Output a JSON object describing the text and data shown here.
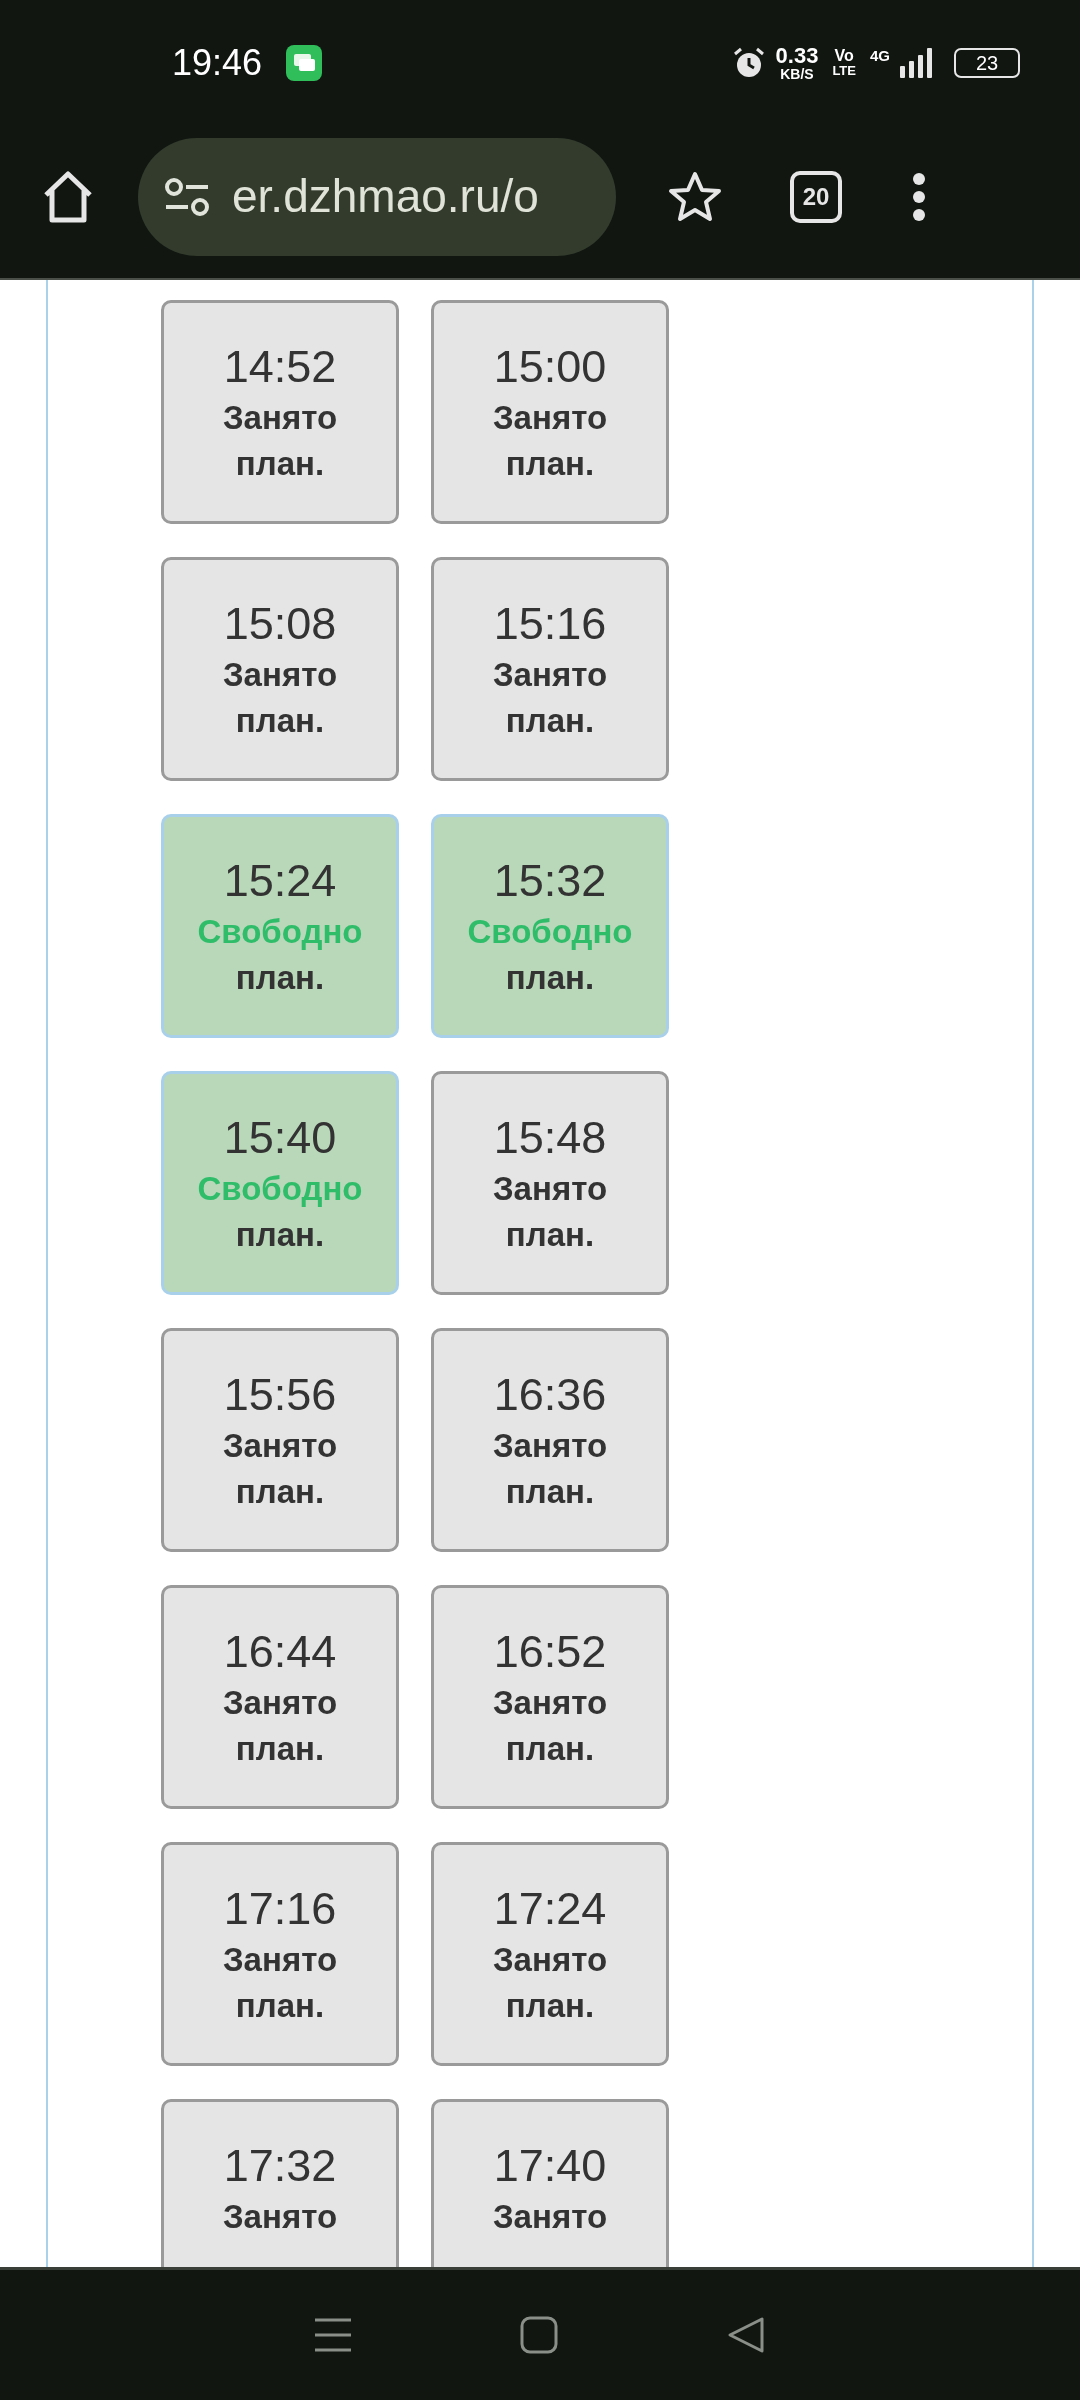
{
  "status_bar": {
    "time": "19:46",
    "speed_value": "0.33",
    "speed_unit": "KB/S",
    "volte_top": "Vo",
    "volte_bottom": "LTE",
    "network": "4G",
    "battery": "23"
  },
  "browser": {
    "url": "er.dzhmao.ru/o",
    "tab_count": "20"
  },
  "slots": [
    {
      "time": "14:52",
      "status": "Занято",
      "note": "план.",
      "kind": "busy"
    },
    {
      "time": "15:00",
      "status": "Занято",
      "note": "план.",
      "kind": "busy"
    },
    {
      "time": "15:08",
      "status": "Занято",
      "note": "план.",
      "kind": "busy"
    },
    {
      "time": "15:16",
      "status": "Занято",
      "note": "план.",
      "kind": "busy"
    },
    {
      "time": "15:24",
      "status": "Свободно",
      "note": "план.",
      "kind": "free"
    },
    {
      "time": "15:32",
      "status": "Свободно",
      "note": "план.",
      "kind": "free"
    },
    {
      "time": "15:40",
      "status": "Свободно",
      "note": "план.",
      "kind": "free"
    },
    {
      "time": "15:48",
      "status": "Занято",
      "note": "план.",
      "kind": "busy"
    },
    {
      "time": "15:56",
      "status": "Занято",
      "note": "план.",
      "kind": "busy"
    },
    {
      "time": "16:36",
      "status": "Занято",
      "note": "план.",
      "kind": "busy"
    },
    {
      "time": "16:44",
      "status": "Занято",
      "note": "план.",
      "kind": "busy"
    },
    {
      "time": "16:52",
      "status": "Занято",
      "note": "план.",
      "kind": "busy"
    },
    {
      "time": "17:16",
      "status": "Занято",
      "note": "план.",
      "kind": "busy"
    },
    {
      "time": "17:24",
      "status": "Занято",
      "note": "план.",
      "kind": "busy"
    },
    {
      "time": "17:32",
      "status": "Занято",
      "kind": "busy"
    },
    {
      "time": "17:40",
      "status": "Занято",
      "kind": "busy"
    }
  ]
}
